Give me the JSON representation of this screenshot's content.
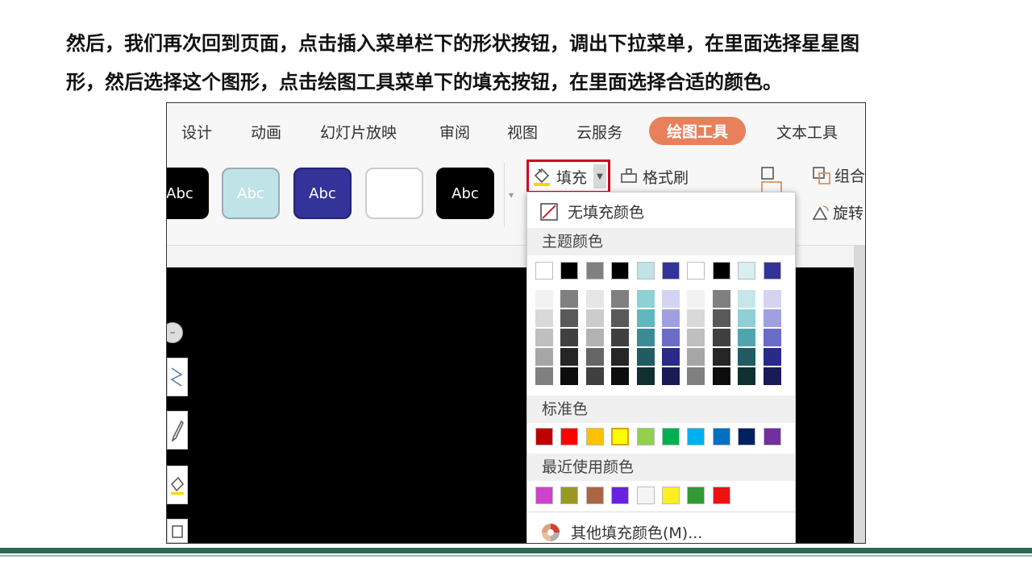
{
  "instruction": {
    "line1": "然后，我们再次回到页面，点击插入菜单栏下的形状按钮，调出下拉菜单，在里面选择星星图",
    "line2": "形，然后选择这个图形，点击绘图工具菜单下的填充按钮，在里面选择合适的颜色。"
  },
  "tabs": [
    "设计",
    "动画",
    "幻灯片放映",
    "审阅",
    "视图",
    "云服务",
    "绘图工具",
    "文本工具"
  ],
  "active_tab_index": 6,
  "style_gallery": [
    {
      "label": "Abc",
      "bg": "#000000",
      "fg": "#ffffff",
      "border": "#000000"
    },
    {
      "label": "Abc",
      "bg": "#bfe3e6",
      "fg": "#ffffff",
      "border": "#9ab"
    },
    {
      "label": "Abc",
      "bg": "#333399",
      "fg": "#ffffff",
      "border": "#222277"
    },
    {
      "label": "",
      "bg": "#ffffff",
      "fg": "#000000",
      "border": "#cccccc"
    },
    {
      "label": "Abc",
      "bg": "#000000",
      "fg": "#ffffff",
      "border": "#000000"
    }
  ],
  "ribbon": {
    "fill_label": "填充",
    "format_painter_label": "格式刷",
    "group_label": "组合",
    "rotate_label": "旋转"
  },
  "dropdown": {
    "no_fill_label": "无填充颜色",
    "theme_colors_label": "主题颜色",
    "theme_colors": [
      "#ffffff",
      "#000000",
      "#808080",
      "#000000",
      "#bfe3e6",
      "#333399",
      "#ffffff",
      "#000000",
      "#d8eef0",
      "#333399"
    ],
    "theme_shades": [
      [
        "#f2f2f2",
        "#d9d9d9",
        "#bfbfbf",
        "#a6a6a6",
        "#808080"
      ],
      [
        "#808080",
        "#595959",
        "#404040",
        "#262626",
        "#0d0d0d"
      ],
      [
        "#e6e6e6",
        "#cccccc",
        "#b3b3b3",
        "#666666",
        "#404040"
      ],
      [
        "#808080",
        "#595959",
        "#404040",
        "#262626",
        "#0d0d0d"
      ],
      [
        "#8fd0d5",
        "#5fb8c0",
        "#3a8c94",
        "#1f5d63",
        "#10302f"
      ],
      [
        "#d4d4f2",
        "#a0a0e0",
        "#6b6bc8",
        "#2a2a88",
        "#1a1a55"
      ],
      [
        "#f2f2f2",
        "#d9d9d9",
        "#bfbfbf",
        "#a6a6a6",
        "#808080"
      ],
      [
        "#808080",
        "#595959",
        "#404040",
        "#262626",
        "#0d0d0d"
      ],
      [
        "#c7e6e9",
        "#8fcfd5",
        "#4fa5ad",
        "#1f5d63",
        "#10302f"
      ],
      [
        "#d4d4f2",
        "#a0a0e0",
        "#6b6bc8",
        "#2a2a88",
        "#1a1a55"
      ]
    ],
    "standard_colors_label": "标准色",
    "standard_colors": [
      "#c00000",
      "#ff0000",
      "#ffc000",
      "#ffff00",
      "#92d050",
      "#00b050",
      "#00b0f0",
      "#0070c0",
      "#002060",
      "#7030a0"
    ],
    "recent_colors_label": "最近使用颜色",
    "recent_colors": [
      "#cc44cc",
      "#999922",
      "#aa6644",
      "#6622dd",
      "#f5f5f5",
      "#ffee22",
      "#339933",
      "#ee1111"
    ],
    "more_colors_label": "其他填充颜色(M)..."
  },
  "colors": {
    "active_tab": "#e8805c",
    "highlight_border": "#d0021b",
    "bottom_bar": "#2f6657"
  }
}
